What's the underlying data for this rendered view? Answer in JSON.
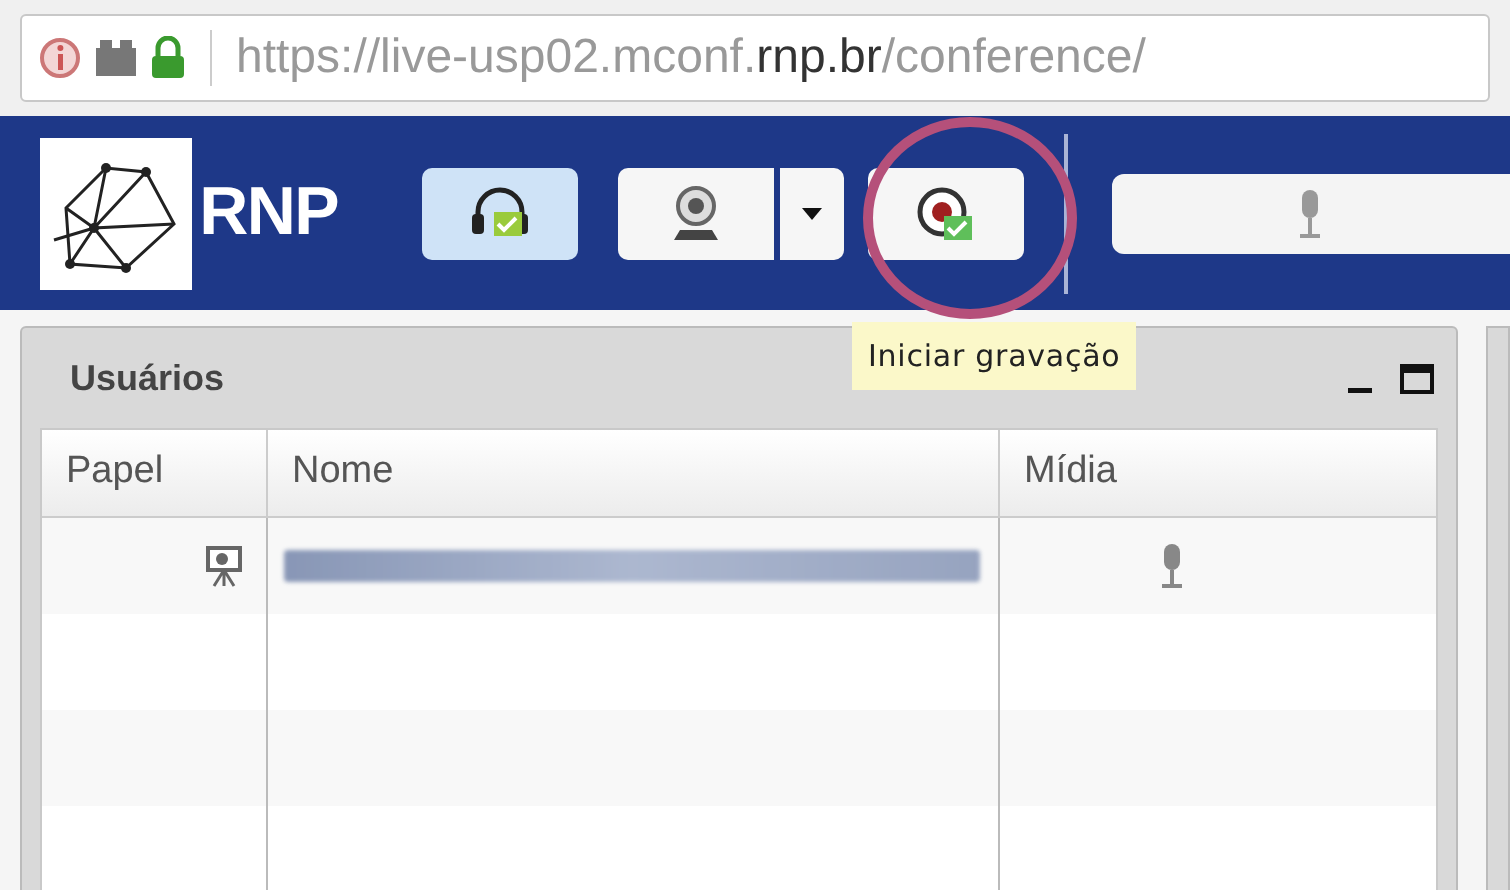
{
  "address_bar": {
    "url_parts": [
      "https://live-usp02.mconf.",
      "rnp.br",
      "/conference/"
    ]
  },
  "toolbar": {
    "brand": "RNP",
    "buttons": [
      {
        "kind": "headset",
        "selected": true
      },
      {
        "kind": "webcam",
        "selected": false
      },
      {
        "kind": "record",
        "selected": false
      }
    ],
    "tooltip": "Iniciar gravação"
  },
  "users_panel": {
    "title": "Usuários",
    "columns": [
      "Papel",
      "Nome",
      "Mídia"
    ],
    "rows": [
      {
        "presenter": true,
        "audio": true
      }
    ]
  }
}
